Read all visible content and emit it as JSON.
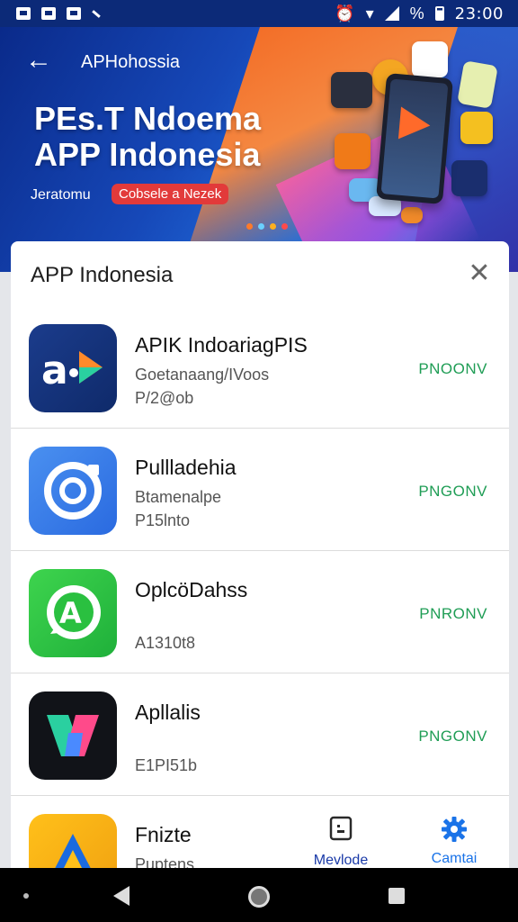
{
  "status_bar": {
    "time": "23:00",
    "battery_pct": "%"
  },
  "hero": {
    "title_small": "APHohossia",
    "headline_line1": "PEs.T Ndoema",
    "headline_line2": "APP Indonesia",
    "subtitle": "Jeratomu",
    "pill_text": "Cobsele a Nezek",
    "dot_colors": [
      "#ff7a2a",
      "#6ad0ff",
      "#ffb020",
      "#ff4a4a"
    ]
  },
  "sheet": {
    "title": "APP Indonesia",
    "apps": [
      {
        "name": "APIK IndoariagPIS",
        "line1": "Goetanaang/IVoos",
        "line2": "P/2@ob",
        "action": "PNOONV"
      },
      {
        "name": "Pullladehia",
        "line1": "Btamenalpe",
        "line2": "P15lnto",
        "action": "PNGONV"
      },
      {
        "name": "OplcöDahss",
        "line1": "",
        "line2": "A1310t8",
        "action": "PNRONV"
      },
      {
        "name": "Apllalis",
        "line1": "",
        "line2": "E1PI51b",
        "action": "PNGONV"
      },
      {
        "name": "Fnizte",
        "line1": "Puptens",
        "line2": "",
        "action": ""
      }
    ],
    "tabs": [
      {
        "label": "Mevlode",
        "icon": "document-icon"
      },
      {
        "label": "Camtai",
        "icon": "gear-icon"
      }
    ]
  },
  "colors": {
    "accent_green": "#1f9d55",
    "accent_blue": "#1a73e8",
    "hero_blue": "#1648b8"
  }
}
